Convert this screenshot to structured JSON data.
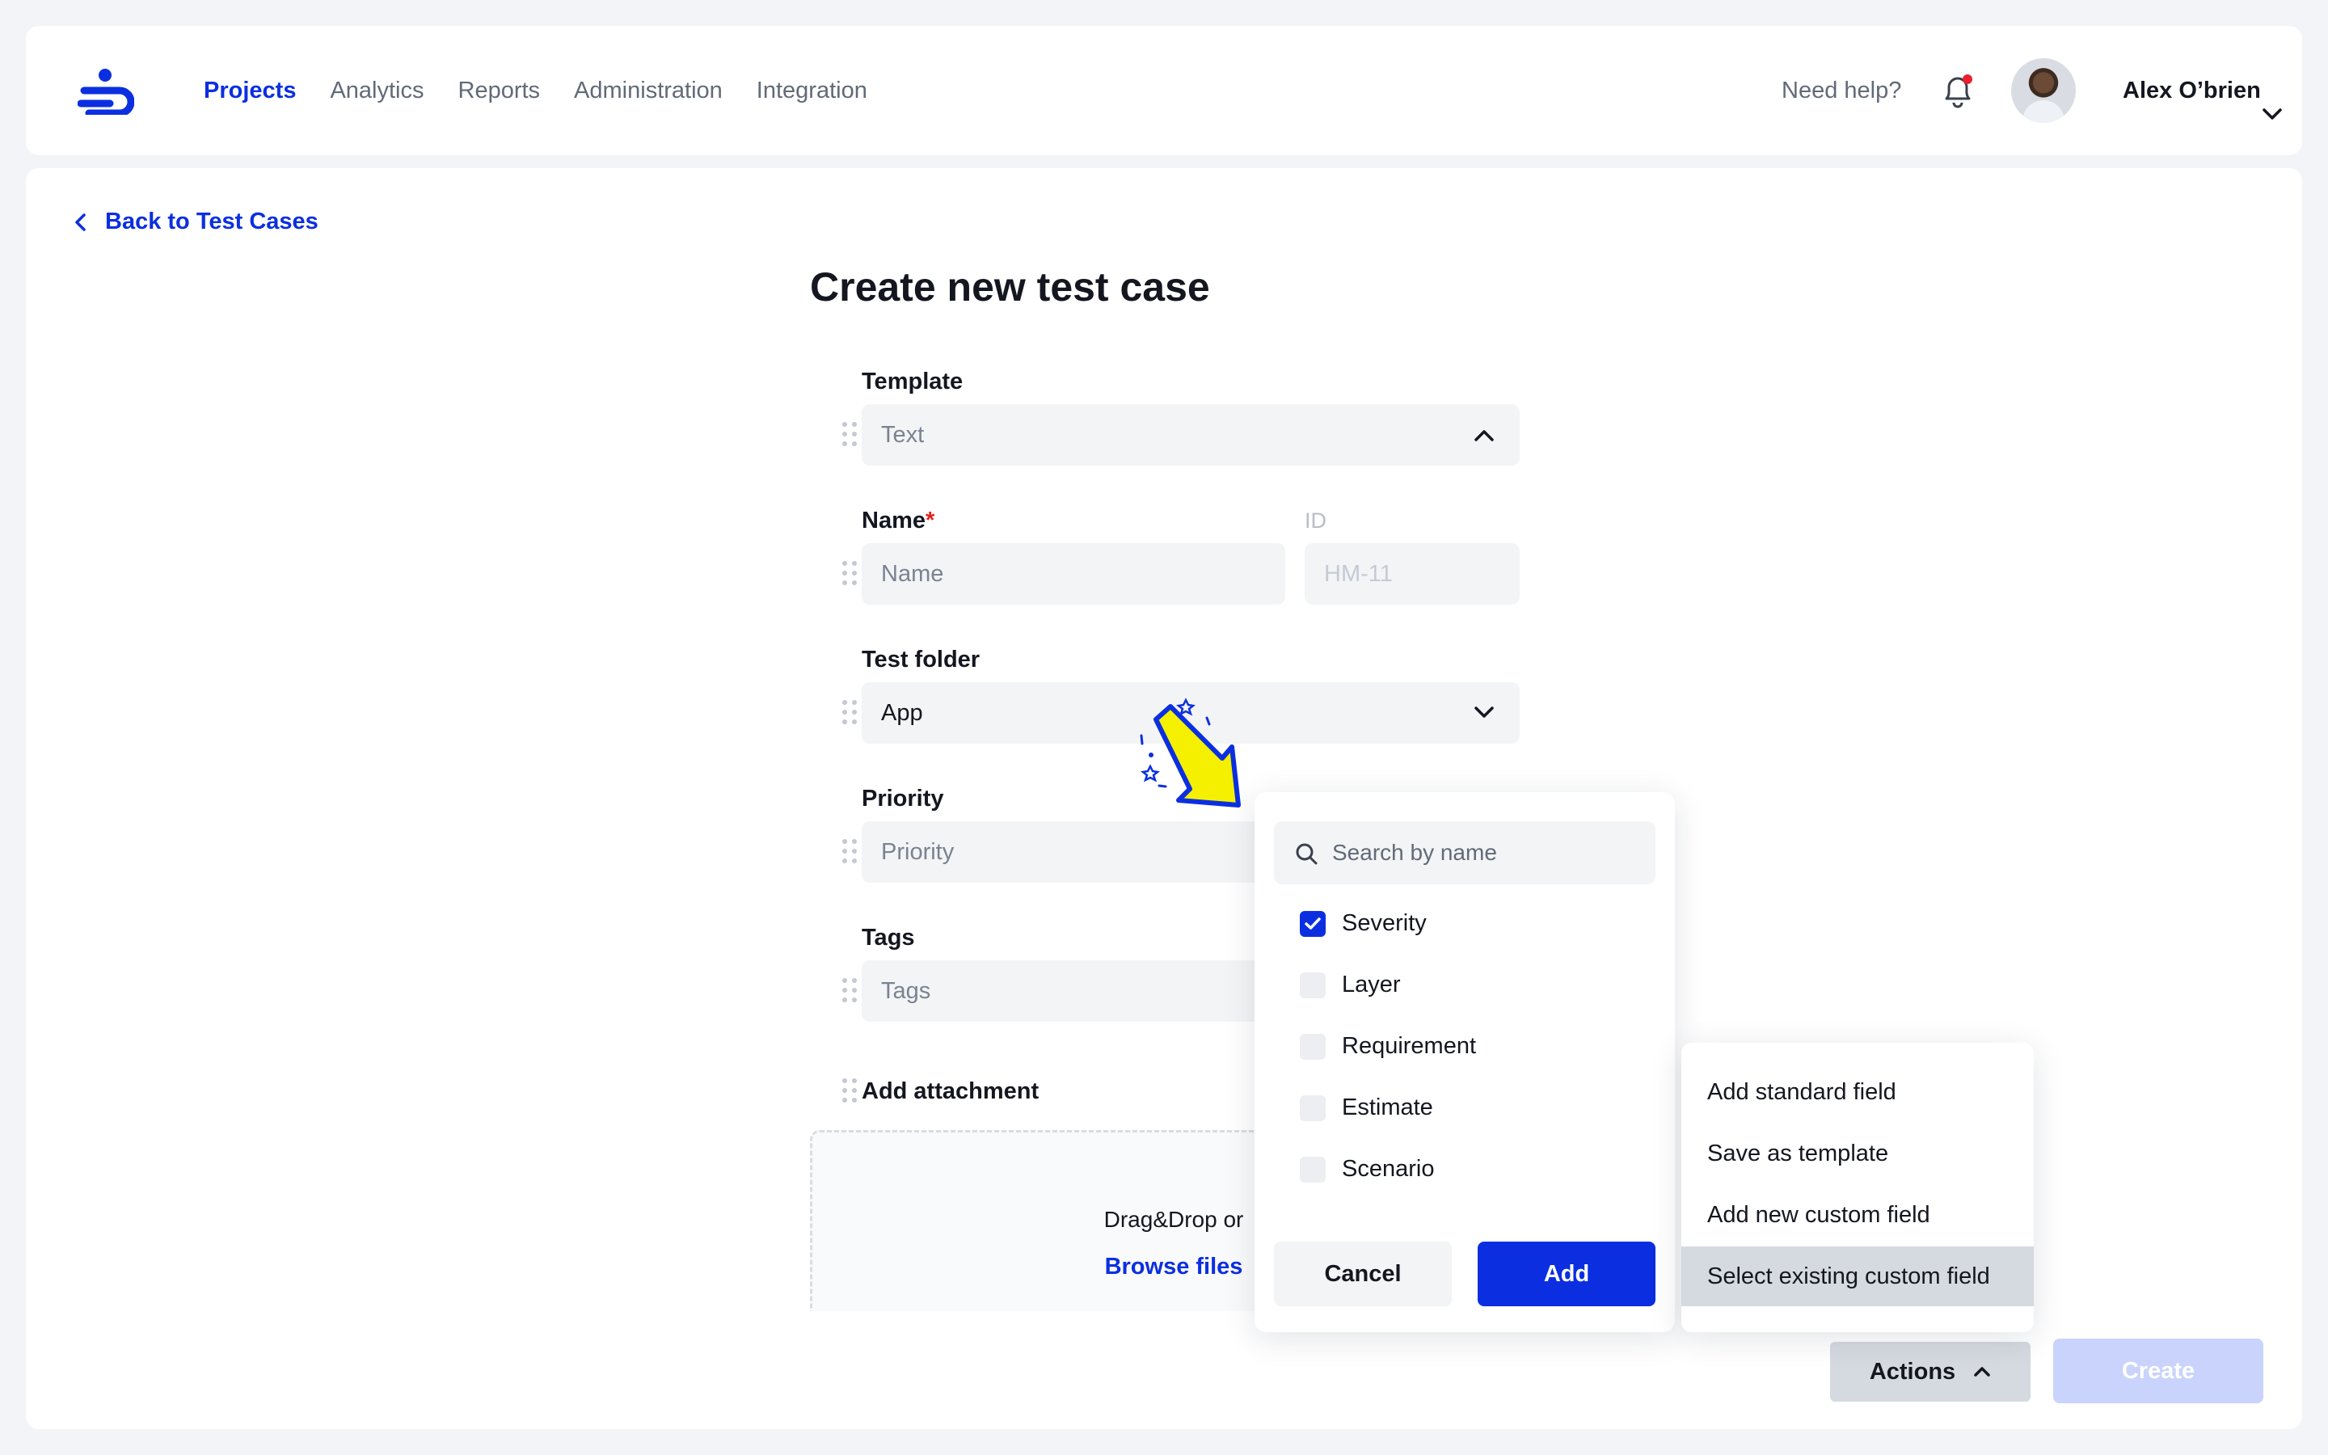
{
  "nav": {
    "items": [
      "Projects",
      "Analytics",
      "Reports",
      "Administration",
      "Integration"
    ],
    "active": "Projects",
    "help": "Need help?",
    "user_name": "Alex O’brien"
  },
  "page": {
    "back_label": "Back to Test Cases",
    "title": "Create new test case"
  },
  "form": {
    "template": {
      "label": "Template",
      "value": "Text"
    },
    "name": {
      "label": "Name",
      "required_mark": "*",
      "placeholder": "Name"
    },
    "id": {
      "label": "ID",
      "value": "HM-11"
    },
    "folder": {
      "label": "Test folder",
      "value": "App"
    },
    "priority": {
      "label": "Priority",
      "placeholder": "Priority"
    },
    "tags": {
      "label": "Tags",
      "placeholder": "Tags"
    },
    "attachment": {
      "label": "Add attachment",
      "drop_text": "Drag&Drop or",
      "browse": "Browse files"
    }
  },
  "popover": {
    "search_placeholder": "Search by name",
    "options": [
      {
        "label": "Severity",
        "checked": true
      },
      {
        "label": "Layer",
        "checked": false
      },
      {
        "label": "Requirement",
        "checked": false
      },
      {
        "label": "Estimate",
        "checked": false
      },
      {
        "label": "Scenario",
        "checked": false
      }
    ],
    "cancel": "Cancel",
    "add": "Add"
  },
  "actions_menu": {
    "items": [
      "Add standard field",
      "Save as template",
      "Add new custom field",
      "Select existing custom field"
    ],
    "highlighted": "Select existing custom field"
  },
  "footer": {
    "actions": "Actions",
    "create": "Create"
  },
  "colors": {
    "accent": "#0b2fe0",
    "required": "#e0241b",
    "notification_dot": "#e8202f",
    "highlight_arrow": "#f4f000"
  }
}
